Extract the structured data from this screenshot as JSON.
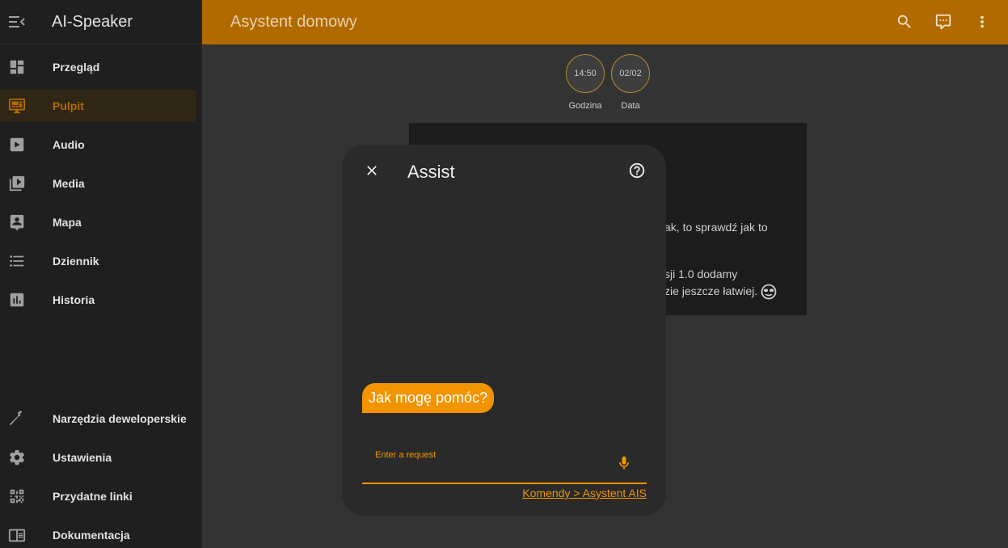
{
  "app": {
    "title": "AI-Speaker"
  },
  "sidebar": {
    "items": [
      {
        "label": "Przegląd",
        "icon": "dashboard-icon",
        "active": false
      },
      {
        "label": "Pulpit",
        "icon": "monitor-dashboard-icon",
        "active": true
      },
      {
        "label": "Audio",
        "icon": "play-box-icon",
        "active": false
      },
      {
        "label": "Media",
        "icon": "play-box-multiple-icon",
        "active": false
      },
      {
        "label": "Mapa",
        "icon": "account-box-icon",
        "active": false
      },
      {
        "label": "Dziennik",
        "icon": "format-list-bulleted-icon",
        "active": false
      },
      {
        "label": "Historia",
        "icon": "chart-box-icon",
        "active": false
      }
    ],
    "bottom_items": [
      {
        "label": "Narzędzia deweloperskie",
        "icon": "hammer-icon"
      },
      {
        "label": "Ustawienia",
        "icon": "cog-icon"
      },
      {
        "label": "Przydatne linki",
        "icon": "qrcode-icon"
      },
      {
        "label": "Dokumentacja",
        "icon": "book-icon"
      }
    ]
  },
  "topbar": {
    "title": "Asystent domowy"
  },
  "badges": [
    {
      "value": "14:50",
      "label": "Godzina"
    },
    {
      "value": "02/02",
      "label": "Data"
    }
  ],
  "card": {
    "line1": "ak, to sprawdź jak to",
    "line2": "sji 1.0 dodamy",
    "line3": "zie jeszcze łatwiej."
  },
  "dialog": {
    "title": "Assist",
    "message": "Jak mogę pomóc?",
    "input_label": "Enter a request",
    "input_value": "",
    "link_text": "Komendy > Asystent AIS"
  },
  "colors": {
    "accent": "#f29400",
    "topbar": "#b06a00",
    "sidebar_bg": "#1f1f1f",
    "main_bg": "#333333"
  }
}
